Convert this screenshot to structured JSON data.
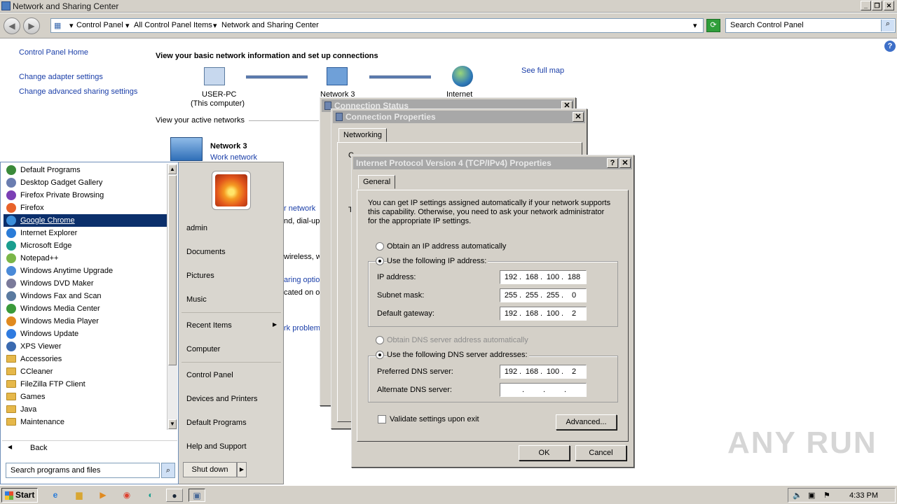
{
  "window": {
    "title": "Network and Sharing Center"
  },
  "address": {
    "crumbs": [
      "Control Panel",
      "All Control Panel Items",
      "Network and Sharing Center"
    ],
    "search_placeholder": "Search Control Panel"
  },
  "sidebar": {
    "items": [
      "Control Panel Home",
      "Change adapter settings",
      "Change advanced sharing settings"
    ]
  },
  "main": {
    "heading": "View your basic network information and set up connections",
    "map": {
      "computer": "USER-PC",
      "computer_sub": "(This computer)",
      "network": "Network 3",
      "internet": "Internet",
      "full_map": "See full map"
    },
    "active_label": "View your active networks",
    "active_network": {
      "name": "Network 3",
      "type": "Work network"
    },
    "partial_texts": [
      "r network",
      "nd, dial-up",
      "wireless, w",
      "aring optio",
      "cated on o",
      "rk problem"
    ]
  },
  "conn_status": {
    "title": "Connection Status"
  },
  "conn_props": {
    "title": "Connection Properties",
    "tab": "Networking",
    "partial_label": "C",
    "partial_label2": "T"
  },
  "ipv4": {
    "title": "Internet Protocol Version 4 (TCP/IPv4) Properties",
    "tab": "General",
    "description": "You can get IP settings assigned automatically if your network supports this capability. Otherwise, you need to ask your network administrator for the appropriate IP settings.",
    "obtain_ip_auto": "Obtain an IP address automatically",
    "use_following_ip": "Use the following IP address:",
    "ip_label": "IP address:",
    "ip": [
      "192",
      "168",
      "100",
      "188"
    ],
    "subnet_label": "Subnet mask:",
    "subnet": [
      "255",
      "255",
      "255",
      "0"
    ],
    "gateway_label": "Default gateway:",
    "gateway": [
      "192",
      "168",
      "100",
      "2"
    ],
    "obtain_dns_auto": "Obtain DNS server address automatically",
    "use_following_dns": "Use the following DNS server addresses:",
    "pref_dns_label": "Preferred DNS server:",
    "pref_dns": [
      "192",
      "168",
      "100",
      "2"
    ],
    "alt_dns_label": "Alternate DNS server:",
    "alt_dns": [
      "",
      "",
      "",
      ""
    ],
    "validate": "Validate settings upon exit",
    "advanced": "Advanced...",
    "ok": "OK",
    "cancel": "Cancel"
  },
  "start_menu": {
    "programs": [
      {
        "label": "Default Programs",
        "color": "#3a8a3a"
      },
      {
        "label": "Desktop Gadget Gallery",
        "color": "#6a7db0"
      },
      {
        "label": "Firefox Private Browsing",
        "color": "#7b3fb5"
      },
      {
        "label": "Firefox",
        "color": "#e8622a"
      },
      {
        "label": "Google Chrome",
        "color": "#3b8fdb",
        "selected": true
      },
      {
        "label": "Internet Explorer",
        "color": "#2a7cd8"
      },
      {
        "label": "Microsoft Edge",
        "color": "#1a9e8f"
      },
      {
        "label": "Notepad++",
        "color": "#7ab648"
      },
      {
        "label": "Windows Anytime Upgrade",
        "color": "#4a8ad8"
      },
      {
        "label": "Windows DVD Maker",
        "color": "#7a7a9a"
      },
      {
        "label": "Windows Fax and Scan",
        "color": "#5a7aa0"
      },
      {
        "label": "Windows Media Center",
        "color": "#3a9a3a"
      },
      {
        "label": "Windows Media Player",
        "color": "#e08a20"
      },
      {
        "label": "Windows Update",
        "color": "#2f7be0"
      },
      {
        "label": "XPS Viewer",
        "color": "#3a6ab0"
      },
      {
        "label": "Accessories",
        "folder": true
      },
      {
        "label": "CCleaner",
        "folder": true
      },
      {
        "label": "FileZilla FTP Client",
        "folder": true
      },
      {
        "label": "Games",
        "folder": true
      },
      {
        "label": "Java",
        "folder": true
      },
      {
        "label": "Maintenance",
        "folder": true
      }
    ],
    "back": "Back",
    "search_placeholder": "Search programs and files",
    "right": [
      "admin",
      "Documents",
      "Pictures",
      "Music",
      "Recent Items",
      "Computer",
      "Control Panel",
      "Devices and Printers",
      "Default Programs",
      "Help and Support"
    ],
    "shutdown": "Shut down"
  },
  "taskbar": {
    "start": "Start",
    "clock": "4:33 PM"
  },
  "watermark": "ANY RUN"
}
